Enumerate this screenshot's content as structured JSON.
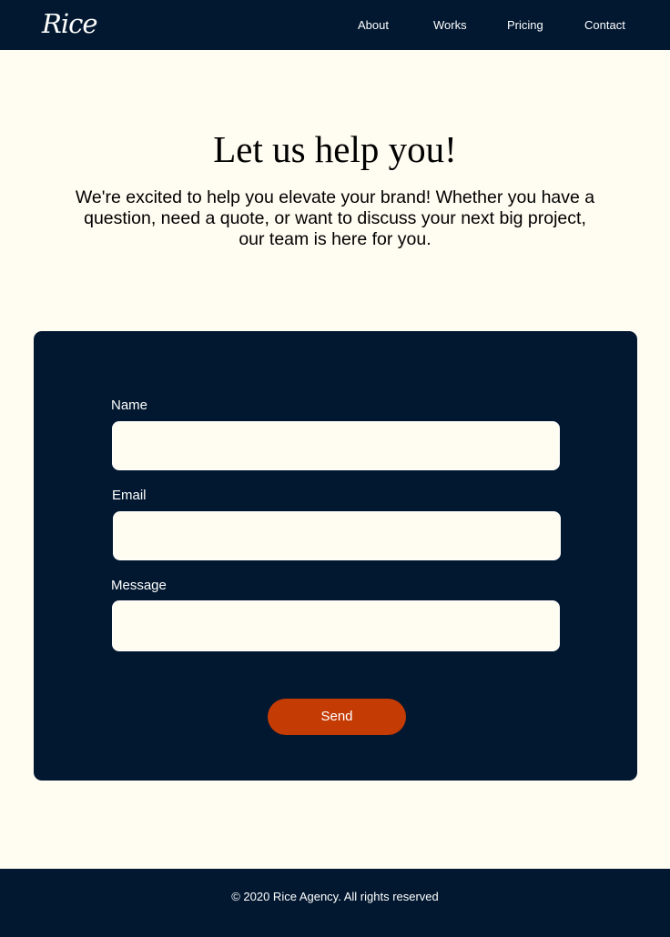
{
  "header": {
    "logo": "Rice",
    "nav": [
      {
        "label": "About"
      },
      {
        "label": "Works"
      },
      {
        "label": "Pricing"
      },
      {
        "label": "Contact"
      }
    ]
  },
  "hero": {
    "title": "Let us help you!",
    "description": "We're excited to help you elevate your brand! Whether you have a question, need a quote, or want to discuss your next big project, our team is here for you."
  },
  "form": {
    "fields": [
      {
        "label": "Name",
        "value": ""
      },
      {
        "label": "Email",
        "value": ""
      },
      {
        "label": "Message",
        "value": ""
      }
    ],
    "submit_label": "Send"
  },
  "footer": {
    "copyright": "© 2020 Rice Agency. All rights reserved"
  },
  "colors": {
    "navy": "#021830",
    "cream": "#fffcf1",
    "accent": "#c53b04",
    "text": "#000000",
    "white": "#ffffff"
  }
}
